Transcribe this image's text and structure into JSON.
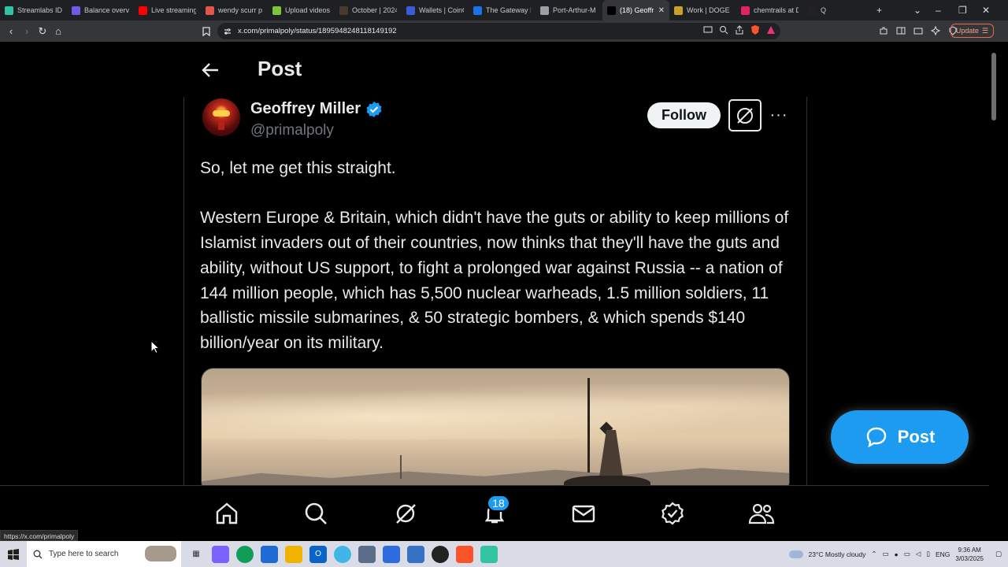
{
  "browser": {
    "tabs": [
      {
        "title": "Streamlabs ID",
        "color": "#31c3a2"
      },
      {
        "title": "Balance overvi",
        "color": "#6c5ce7"
      },
      {
        "title": "Live streaming",
        "color": "#ff0000"
      },
      {
        "title": "wendy scurr p",
        "color": "#e2574c"
      },
      {
        "title": "Upload videos",
        "color": "#7cc53a"
      },
      {
        "title": "October | 2024",
        "color": "#4a3a2a"
      },
      {
        "title": "Wallets | CoinG",
        "color": "#3b5bdb"
      },
      {
        "title": "The Gateway P",
        "color": "#1a73e8"
      },
      {
        "title": "Port-Arthur-M",
        "color": "#9aa0a6"
      },
      {
        "title": "(18) Geoffr",
        "color": "#000000"
      },
      {
        "title": "Work | DOGE |",
        "color": "#c9a227"
      },
      {
        "title": "chemtrails at D",
        "color": "#e0245e"
      },
      {
        "title": "Q",
        "color": "#222222"
      }
    ],
    "new_tab": "+",
    "url": "x.com/primalpoly/status/1895948248118149192",
    "update_label": "Update",
    "status_url": "https://x.com/primalpoly"
  },
  "header": {
    "title": "Post"
  },
  "post": {
    "author_name": "Geoffrey Miller",
    "author_handle": "@primalpoly",
    "follow_label": "Follow",
    "more_label": "···",
    "paragraph1": "So, let me get this straight.",
    "paragraph2": "Western Europe & Britain, which didn't have the guts or ability to keep millions of Islamist invaders out of their countries, now thinks that they'll have the guts and ability, without US support, to fight a prolonged war against Russia -- a nation of 144 million people, which has 5,500 nuclear warheads, 1.5 million soldiers, 11 ballistic missile submarines, & 50 strategic bombers, & which spends $140 billion/year on its military."
  },
  "fab": {
    "label": "Post"
  },
  "bottom_nav": {
    "notifications_badge": "18",
    "icons": [
      "home-icon",
      "search-icon",
      "grok-icon",
      "notifications-icon",
      "messages-icon",
      "verified-icon",
      "communities-icon"
    ]
  },
  "taskbar": {
    "search_placeholder": "Type here to search",
    "weather": "23°C  Mostly cloudy",
    "language": "ENG",
    "time": "9:36 AM",
    "date": "3/03/2025"
  },
  "colors": {
    "accent": "#1d9bf0",
    "background": "#000000",
    "text": "#e7e9ea",
    "muted": "#71767b"
  }
}
